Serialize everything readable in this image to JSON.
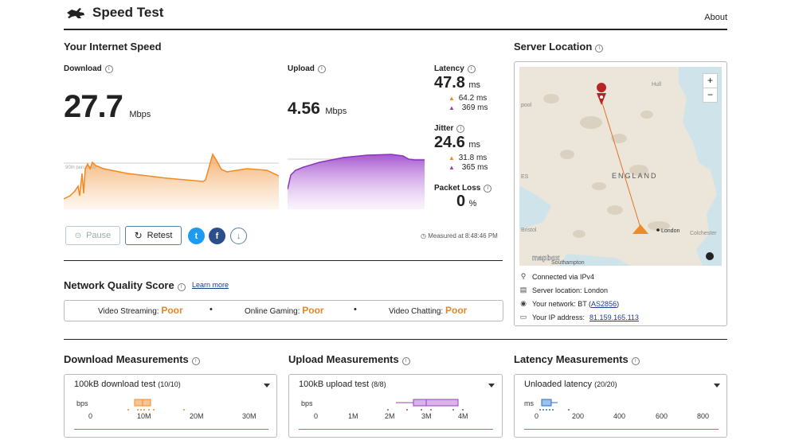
{
  "header": {
    "title": "Speed Test",
    "about": "About",
    "logo_icon": "rabbit-logo-icon"
  },
  "speed": {
    "title": "Your Internet Speed",
    "download": {
      "label": "Download",
      "value": "27.7",
      "unit": "Mbps",
      "color": "#f08a24"
    },
    "upload": {
      "label": "Upload",
      "value": "4.56",
      "unit": "Mbps",
      "color": "#9b3fbf"
    },
    "percentile_label": "90th percentile",
    "latency": {
      "label": "Latency",
      "value": "47.8",
      "unit": "ms",
      "down": "64.2",
      "up": "369",
      "sub_unit": "ms"
    },
    "jitter": {
      "label": "Jitter",
      "value": "24.6",
      "unit": "ms",
      "down": "31.8",
      "up": "365",
      "sub_unit": "ms"
    },
    "packet_loss": {
      "label": "Packet Loss",
      "value": "0",
      "unit": "%"
    },
    "pause": "Pause",
    "retest": "Retest",
    "measured_at": "Measured at 8:48:46 PM"
  },
  "nqs": {
    "title": "Network Quality Score",
    "learn_more": "Learn more",
    "items": [
      {
        "label": "Video Streaming:",
        "value": "Poor"
      },
      {
        "label": "Online Gaming:",
        "value": "Poor"
      },
      {
        "label": "Video Chatting:",
        "value": "Poor"
      }
    ]
  },
  "server": {
    "title": "Server Location",
    "map_labels": {
      "england": "ENGLAND",
      "london": "London",
      "hull": "Hull",
      "bristol": "Bristol",
      "southampton": "Southampton",
      "colchester": "Colchester",
      "es": "ES",
      "pool": "pool",
      "mapbox": "mapbox"
    },
    "zoom_in": "+",
    "zoom_out": "−",
    "connected": "Connected via IPv4",
    "location": "Server location: London",
    "network_prefix": "Your network: BT (",
    "network_asn": "AS2856",
    "network_suffix": ")",
    "ip_label": "Your IP address:",
    "ip": "81.159.165.113"
  },
  "measurements": [
    {
      "title": "Download Measurements",
      "select": "100kB download test",
      "count": "(10/10)",
      "unit": "bps",
      "ticks": [
        "0",
        "10M",
        "20M",
        "30M"
      ],
      "color": "#f08a24"
    },
    {
      "title": "Upload Measurements",
      "select": "100kB upload test",
      "count": "(8/8)",
      "unit": "bps",
      "ticks": [
        "0",
        "1M",
        "2M",
        "3M",
        "4M"
      ],
      "color": "#9b3fbf"
    },
    {
      "title": "Latency Measurements",
      "select": "Unloaded latency",
      "count": "(20/20)",
      "unit": "ms",
      "ticks": [
        "0",
        "200",
        "400",
        "600",
        "800"
      ],
      "color": "#2a6ecf"
    }
  ]
}
